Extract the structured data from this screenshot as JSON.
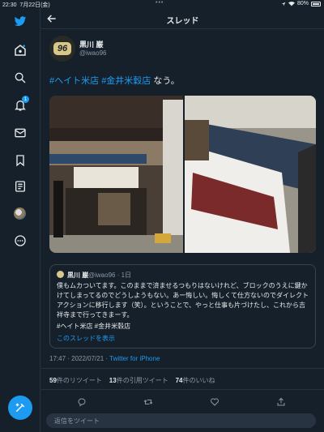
{
  "status_bar": {
    "time": "22:30",
    "date": "7月22日(金)",
    "battery": "80%"
  },
  "header": {
    "title": "スレッド"
  },
  "sidebar": {
    "notification_count": "1"
  },
  "tweet": {
    "name": "黒川 巌",
    "handle": "@iwao96",
    "avatar_text": "96",
    "text_tag1": "#ヘイト米店",
    "text_tag2": "#金井米穀店",
    "text_tail": " なう。",
    "timestamp": "17:47 · 2022/07/21 · ",
    "client": "Twitter for iPhone",
    "retweets": "59",
    "retweets_label": "件のリツイート",
    "quotes": "13",
    "quotes_label": "件の引用ツイート",
    "likes": "74",
    "likes_label": "件のいいね"
  },
  "quote": {
    "name": "黒川 巌",
    "handle": "@iwao96 · 1日",
    "body": "僕もムカついてます。このままで済ませるつもりはないけれど、ブロックのうえに鍵かけてしまってるのでどうしようもない。あー悔しい。悔しくて仕方ないのでダイレクトアクションに移行します（笑）。ということで、やっと仕事も片づけたし、これから吉祥寺まで行ってきまーす。",
    "tags": "#ヘイト米店 #金井米穀店",
    "show_thread": "このスレッドを表示"
  },
  "reply": {
    "placeholder": "返信をツイート"
  },
  "colors": {
    "background": "#15202b",
    "accent": "#1d9bf0",
    "muted": "#8b98a5"
  }
}
